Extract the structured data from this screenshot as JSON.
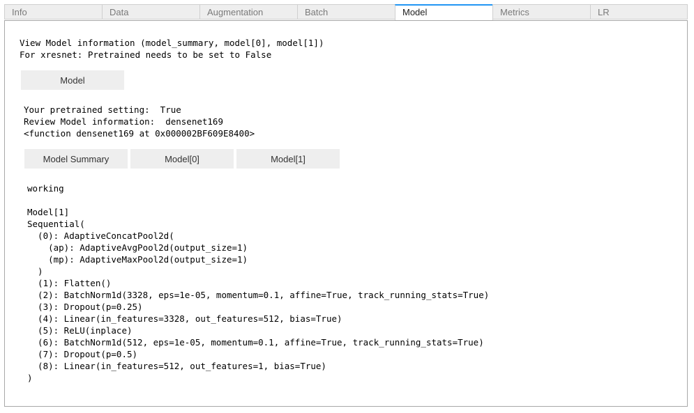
{
  "tabs": [
    {
      "label": "Info"
    },
    {
      "label": "Data"
    },
    {
      "label": "Augmentation"
    },
    {
      "label": "Batch"
    },
    {
      "label": "Model"
    },
    {
      "label": "Metrics"
    },
    {
      "label": "LR"
    }
  ],
  "active_tab": "Model",
  "intro": {
    "line1": "View Model information (model_summary, model[0], model[1])",
    "line2": "For xresnet: Pretrained needs to be set to False"
  },
  "model_button": "Model",
  "info": {
    "pretrained": "Your pretrained setting:  True",
    "review": "Review Model information:  densenet169",
    "function": "<function densenet169 at 0x000002BF609E8400>"
  },
  "buttons": {
    "summary": "Model Summary",
    "model0": "Model[0]",
    "model1": "Model[1]"
  },
  "output": {
    "status": "working",
    "lines": [
      "Model[1]",
      "Sequential(",
      "  (0): AdaptiveConcatPool2d(",
      "    (ap): AdaptiveAvgPool2d(output_size=1)",
      "    (mp): AdaptiveMaxPool2d(output_size=1)",
      "  )",
      "  (1): Flatten()",
      "  (2): BatchNorm1d(3328, eps=1e-05, momentum=0.1, affine=True, track_running_stats=True)",
      "  (3): Dropout(p=0.25)",
      "  (4): Linear(in_features=3328, out_features=512, bias=True)",
      "  (5): ReLU(inplace)",
      "  (6): BatchNorm1d(512, eps=1e-05, momentum=0.1, affine=True, track_running_stats=True)",
      "  (7): Dropout(p=0.5)",
      "  (8): Linear(in_features=512, out_features=1, bias=True)",
      ")"
    ]
  }
}
